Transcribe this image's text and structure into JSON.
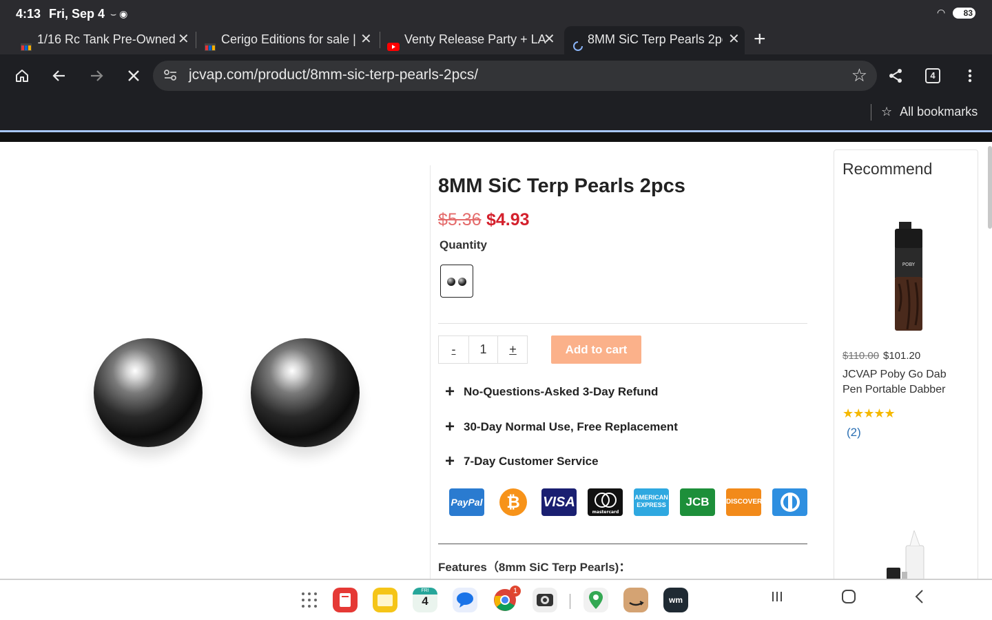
{
  "status_bar": {
    "time": "4:13",
    "date": "Fri, Sep 4",
    "battery": "83"
  },
  "tabs": [
    {
      "title": "1/16 Rc Tank Pre-Owned",
      "close": "✕"
    },
    {
      "title": "Cerigo Editions for sale |",
      "close": "✕"
    },
    {
      "title": "Venty Release Party + LA",
      "close": "✕"
    },
    {
      "title": "8MM SiC Terp Pearls 2pc",
      "close": "✕"
    }
  ],
  "new_tab": "+",
  "toolbar": {
    "url": "jcvap.com/product/8mm-sic-terp-pearls-2pcs/",
    "tab_count": "4"
  },
  "bookmarks": {
    "label": "All bookmarks"
  },
  "product": {
    "title": "8MM SiC Terp Pearls 2pcs",
    "old_price": "$5.36",
    "price": "$4.93",
    "quantity_label": "Quantity",
    "qty_minus": "-",
    "qty_value": "1",
    "qty_plus": "+",
    "add_to_cart": "Add to cart",
    "perks": [
      "No-Questions-Asked 3-Day Refund",
      "30-Day Normal Use, Free Replacement",
      "7-Day Customer Service"
    ],
    "payment_methods": [
      "PayPal",
      "Bitcoin",
      "VISA",
      "mastercard",
      "AMERICAN EXPRESS",
      "JCB",
      "DISCOVER",
      "Diners Club"
    ],
    "features_heading": "Features（8mm SiC Terp Pearls)："
  },
  "recommend": {
    "title": "Recommend",
    "item": {
      "old_price": "$110.00",
      "price": "$101.20",
      "name": "JCVAP Poby Go Dab Pen Portable Dabber",
      "rating_stars": 5,
      "review_count": "(2)",
      "brand_mark": "POBY"
    }
  },
  "dock": {
    "calendar_day": "FRI",
    "calendar_date": "4",
    "chrome_badge": "1",
    "wm_label": "wm"
  },
  "colors": {
    "accent_price": "#d4202c",
    "add_to_cart_bg": "#fbb18a",
    "chrome_dark": "#1e1f23"
  }
}
